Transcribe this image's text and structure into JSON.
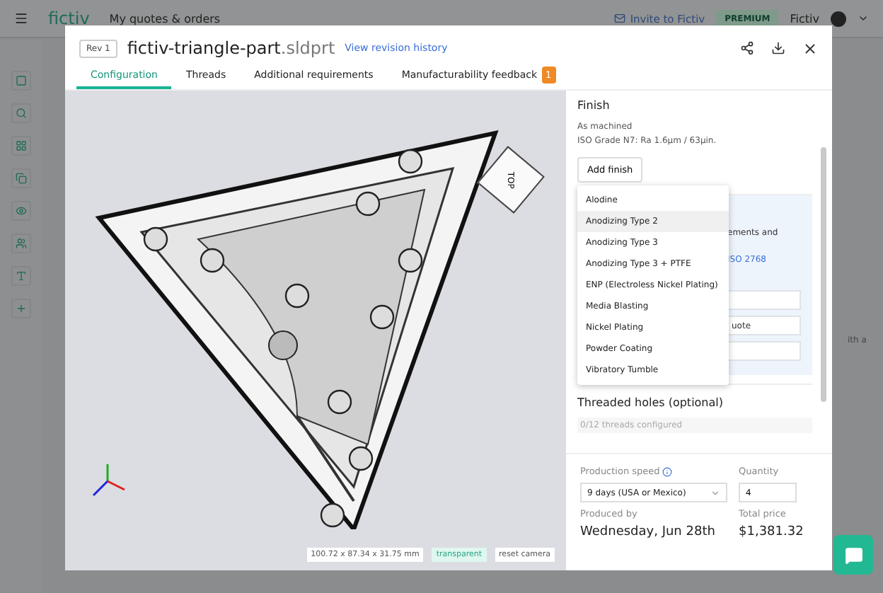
{
  "app": {
    "logo": "fictiv",
    "title": "My quotes & orders",
    "invite": "Invite to Fictiv",
    "plan": "PREMIUM",
    "account": "Fictiv",
    "background_fragment": "ith a"
  },
  "modal": {
    "revision": "Rev 1",
    "file_name": "fictiv-triangle-part",
    "file_ext": ".sldprt",
    "history_link": "View revision history",
    "tabs": [
      {
        "label": "Configuration",
        "selected": true
      },
      {
        "label": "Threads",
        "selected": false
      },
      {
        "label": "Additional requirements",
        "selected": false
      },
      {
        "label": "Manufacturability feedback",
        "selected": false,
        "badge": "1"
      }
    ]
  },
  "viewer": {
    "viewcube_label": "TOP",
    "dimensions": "100.72 x 87.34 x 31.75 mm",
    "transparent": {
      "label": "transparent",
      "on": true
    },
    "reset": "reset camera"
  },
  "finish": {
    "heading": "Finish",
    "current": "As machined",
    "grade": "ISO Grade N7: Ra 1.6µm / 63µin.",
    "add_button": "Add finish",
    "options": [
      {
        "label": "Alodine",
        "selected": false
      },
      {
        "label": "Anodizing Type 2",
        "selected": true
      },
      {
        "label": "Anodizing Type 3",
        "selected": false
      },
      {
        "label": "Anodizing Type 3 + PTFE",
        "selected": false
      },
      {
        "label": "ENP (Electroless Nickel Plating)",
        "selected": false
      },
      {
        "label": "Media Blasting",
        "selected": false
      },
      {
        "label": "Nickel Plating",
        "selected": false
      },
      {
        "label": "Powder Coating",
        "selected": false
      },
      {
        "label": "Vibratory Tumble",
        "selected": false
      }
    ]
  },
  "tolerance": {
    "text_fragment": "ements and",
    "link_fragment": "ISO 2768",
    "field_fragment": "uote"
  },
  "threads": {
    "heading": "Threaded holes (optional)",
    "status": "0/12 threads configured"
  },
  "order": {
    "speed_label": "Production speed",
    "speed_value": "9 days (USA or Mexico)",
    "quantity_label": "Quantity",
    "quantity": "4",
    "produced_label": "Produced by",
    "produced_date": "Wednesday, Jun 28th",
    "price_label": "Total price",
    "price": "$1,381.32"
  }
}
